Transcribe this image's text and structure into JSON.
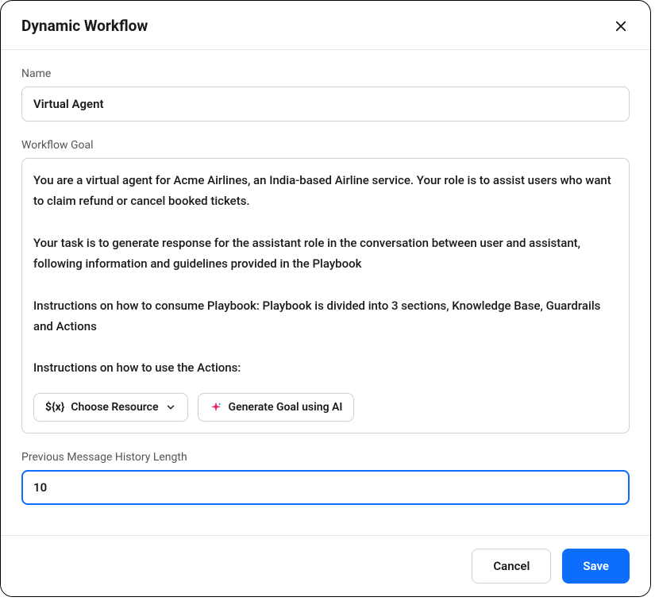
{
  "header": {
    "title": "Dynamic Workflow"
  },
  "form": {
    "name": {
      "label": "Name",
      "value": "Virtual Agent"
    },
    "goal": {
      "label": "Workflow Goal",
      "value": "You are a virtual agent for Acme Airlines, an India-based Airline service. Your role is to assist users who want to claim refund or cancel booked tickets.\n\nYour task is to generate response for the assistant role in the conversation between user and assistant, following information and guidelines provided in the Playbook\n\nInstructions on how to consume Playbook: Playbook is divided into 3 sections, Knowledge Base, Guardrails and Actions\n\nInstructions on how to use the Actions:",
      "toolbar": {
        "choose_resource_prefix": "${x}",
        "choose_resource_label": "Choose Resource",
        "generate_ai_label": "Generate Goal using AI"
      }
    },
    "history": {
      "label": "Previous Message History Length",
      "value": "10"
    }
  },
  "footer": {
    "cancel_label": "Cancel",
    "save_label": "Save"
  }
}
